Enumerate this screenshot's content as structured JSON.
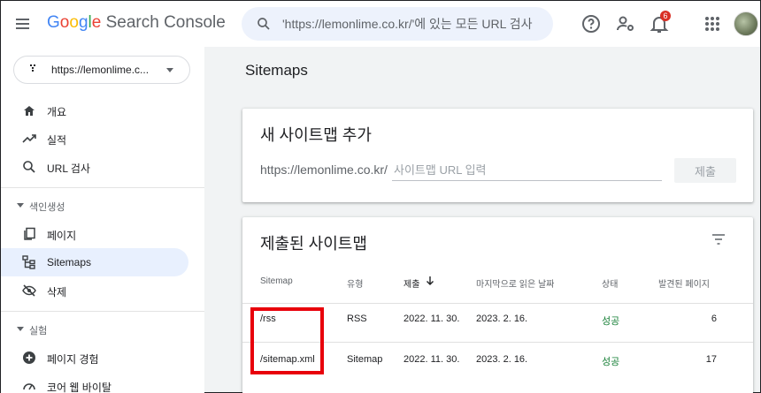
{
  "header": {
    "logo": {
      "G": "G",
      "o1": "o",
      "o2": "o",
      "g": "g",
      "l": "l",
      "e": "e",
      "product": "Search Console"
    },
    "search_placeholder": "'https://lemonlime.co.kr/'에 있는 모든 URL 검사",
    "notification_count": "6"
  },
  "sidebar": {
    "property": "https://lemonlime.c...",
    "nav_top": [
      {
        "label": "개요",
        "icon": "home-icon"
      },
      {
        "label": "실적",
        "icon": "trending-up-icon"
      },
      {
        "label": "URL 검사",
        "icon": "search-icon"
      }
    ],
    "section_indexing": "색인생성",
    "nav_indexing": [
      {
        "label": "페이지",
        "icon": "pages-icon"
      },
      {
        "label": "Sitemaps",
        "icon": "sitemap-icon"
      },
      {
        "label": "삭제",
        "icon": "visibility-off-icon"
      }
    ],
    "section_experience": "실험",
    "nav_experience": [
      {
        "label": "페이지 경험",
        "icon": "add-circle-icon"
      },
      {
        "label": "코어 웹 바이탈",
        "icon": "speed-icon"
      }
    ]
  },
  "main": {
    "page_title": "Sitemaps",
    "add_card": {
      "title": "새 사이트맵 추가",
      "url_prefix": "https://lemonlime.co.kr/",
      "input_placeholder": "사이트맵 URL 입력",
      "submit_label": "제출"
    },
    "submitted_card": {
      "title": "제출된 사이트맵",
      "columns": [
        "Sitemap",
        "유형",
        "제출",
        "마지막으로 읽은 날짜",
        "상태",
        "발견된 페이지"
      ],
      "rows": [
        {
          "sitemap": "/rss",
          "type": "RSS",
          "submitted": "2022. 11. 30.",
          "last_read": "2023. 2. 16.",
          "status": "성공",
          "pages": "6"
        },
        {
          "sitemap": "/sitemap.xml",
          "type": "Sitemap",
          "submitted": "2022. 11. 30.",
          "last_read": "2023. 2. 16.",
          "status": "성공",
          "pages": "17"
        }
      ]
    }
  },
  "colors": {
    "accent": "#1a73e8",
    "success": "#188038",
    "highlight": "#e8000b"
  }
}
